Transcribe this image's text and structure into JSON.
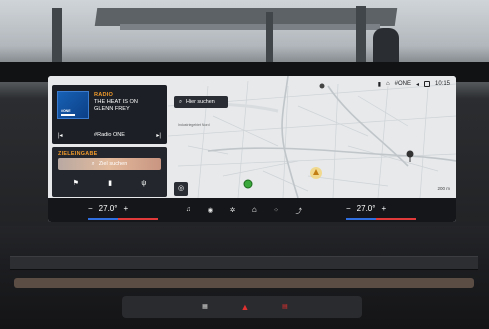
{
  "status_bar": {
    "channel_label": "#ONE",
    "time": "10:15"
  },
  "media": {
    "source_label": "RADIO",
    "song_title": "THE HEAT IS ON",
    "artist": "GLENN FREY",
    "station_name": "#Radio ONE",
    "cover_label": "#ONE",
    "prev_icon": "previous-track-icon",
    "next_icon": "next-track-icon"
  },
  "destination": {
    "section_title": "ZIELEINGABE",
    "search_label": "Ziel suchen",
    "search_icon": "magnifier",
    "shortcuts": [
      "flag-icon",
      "fuel-icon",
      "restaurant-icon"
    ]
  },
  "map": {
    "search_label": "Hier suchen",
    "place_label": "Industriegebiet Nord",
    "scale_label": "200 m"
  },
  "climate": {
    "left_temp": "27.0°",
    "right_temp": "27.0°",
    "minus_label": "−",
    "plus_label": "+"
  },
  "bottom_nav": [
    "music-note-icon",
    "phone-icon",
    "fan-icon",
    "home-icon",
    "apps-icon",
    "navigation-icon"
  ],
  "colors": {
    "accent": "#f29a2a",
    "cold": "#2f6fe0",
    "warm": "#e03a3a"
  }
}
